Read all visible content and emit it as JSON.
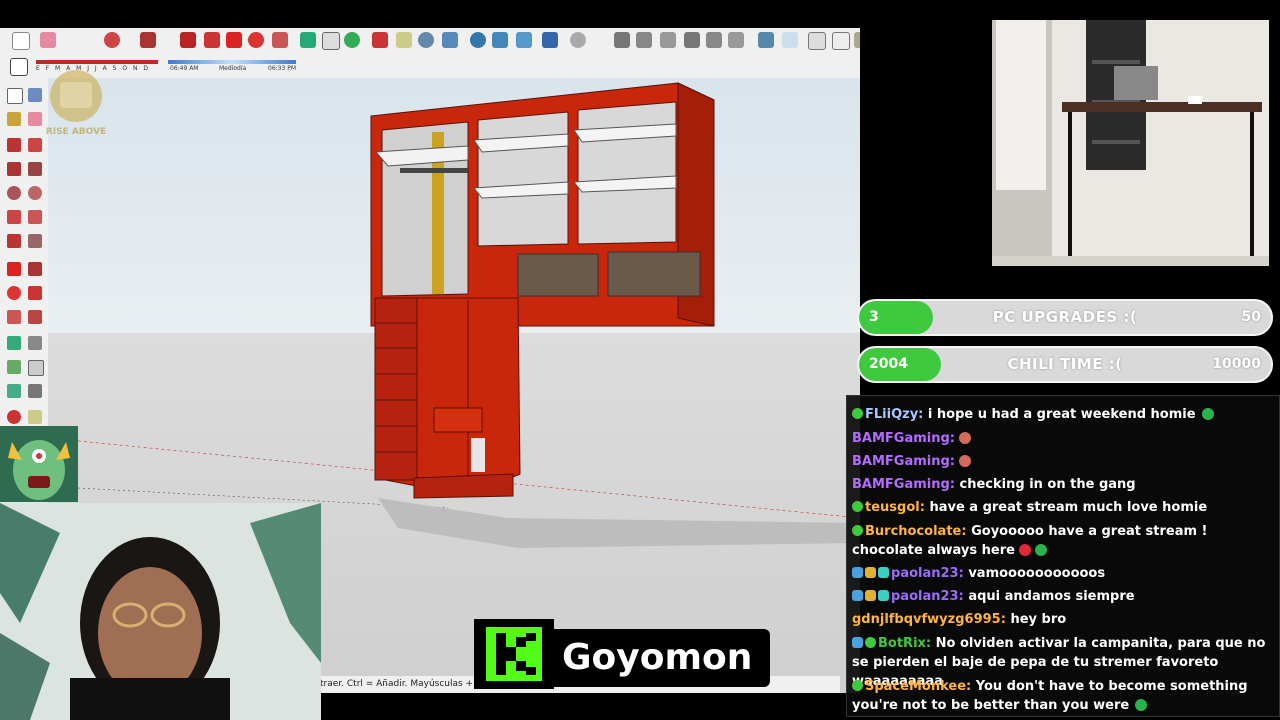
{
  "colors": {
    "accent_green": "#3fc93f",
    "cabinet_red": "#c9270c",
    "kick_green": "#53fc18"
  },
  "sketchup": {
    "shadow_start": "06:49 AM",
    "shadow_mid": "Mediodía",
    "shadow_end": "06:33 PM",
    "months": "E F M A M J J A S O N D",
    "status_text": "traer. Ctrl = Añadir. Mayúsculas + Ctrl ="
  },
  "goals": [
    {
      "current": "3",
      "label": "PC UPGRADES :(",
      "target": "50",
      "progress": 0.06
    },
    {
      "current": "2004",
      "label": "CHILI TIME :(",
      "target": "10000",
      "progress": 0.2
    }
  ],
  "chat": [
    {
      "user": "FLiiQzy",
      "color": "#a9c8ff",
      "text": "i hope u had a great weekend homie",
      "badges": [
        "green"
      ],
      "emote": "green-heart"
    },
    {
      "user": "BAMFGaming",
      "color": "#b46bff",
      "text": "",
      "badges": [],
      "emote": "face"
    },
    {
      "user": "BAMFGaming",
      "color": "#b46bff",
      "text": "",
      "badges": [],
      "emote": "face"
    },
    {
      "user": "BAMFGaming",
      "color": "#b46bff",
      "text": "checking in on the gang",
      "badges": [],
      "emote": ""
    },
    {
      "user": "teusgol",
      "color": "#ffb347",
      "text": "have a great stream much love homie",
      "badges": [
        "green"
      ],
      "emote": ""
    },
    {
      "user": "Burchocolate",
      "color": "#ffb347",
      "text": "Goyooooo have a great stream ! chocolate always here",
      "badges": [
        "green"
      ],
      "emote": "hearts"
    },
    {
      "user": "paolan23",
      "color": "#9b6bff",
      "text": "vamooooooooooos",
      "badges": [
        "blue",
        "gold",
        "teal"
      ],
      "emote": ""
    },
    {
      "user": "paolan23",
      "color": "#9b6bff",
      "text": "aqui andamos siempre",
      "badges": [
        "blue",
        "gold",
        "teal"
      ],
      "emote": ""
    },
    {
      "user": "gdnjlfbqvfwyzg6995",
      "color": "#ffb347",
      "text": "hey bro",
      "badges": [],
      "emote": ""
    },
    {
      "user": "BotRix",
      "color": "#3fc93f",
      "text": "No olviden activar la campanita, para que no se pierden el baje de pepa de tu stremer favoreto waaaaaaaaa",
      "badges": [
        "blue",
        "green"
      ],
      "emote": ""
    },
    {
      "user": "SpaceMonkee",
      "color": "#ffb347",
      "text": "You don't have to become something you're not to be better than you were",
      "badges": [
        "green"
      ],
      "emote": "green-heart"
    }
  ],
  "kick": {
    "logo": "K",
    "channel": "Goyomon"
  },
  "overlay_logo_text": "TEAM RISE ABOVE"
}
